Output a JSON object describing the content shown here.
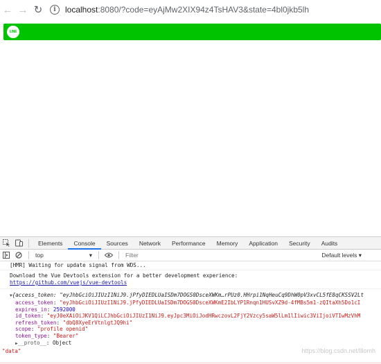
{
  "browser": {
    "url_host": "localhost",
    "url_rest": ":8080/?code=eyAjMw2XIX94z4TsHAV3&state=4bl0jkb5lh"
  },
  "line_logo_text": "LINE",
  "devtools": {
    "tabs": [
      "Elements",
      "Console",
      "Sources",
      "Network",
      "Performance",
      "Memory",
      "Application",
      "Security",
      "Audits"
    ],
    "active_tab": "Console",
    "context": "top",
    "filter_placeholder": "Filter",
    "levels": "Default levels ▾",
    "messages": {
      "hmr": "[HMR] Waiting for update signal from WDS...",
      "devtools_1": "Download the Vue Devtools extension for a better development experience:",
      "devtools_link": "https://github.com/vuejs/vue-devtools"
    },
    "object": {
      "summary": "{access_token: \"eyJhbGciOiJIUzI1NiJ9.jPfyDIEDLUaISDm7DOGS0DsceXWKm…rPUz0.HHrpi1NqHeuCq9DhW0pV3xvCL5fE8qCKSSV2Lt",
      "access_token": "\"eyJhbGciOiJIUzI1NiJ9.jPfyDIEDLUaISDm7DOGS0DsceXWKmE2IbLYP1Rnqn1HUSvXZ9d-4fMBs5m1-zQItaXh5Do1cI",
      "expires_in": "2592000",
      "id_token": "\"eyJ0eXAiOiJKV1QiLCJhbGciOiJIUzI1NiJ9.eyJpc3MiOiJodHRwczovL2FjY2Vzcy5saW5lLm1lIiwic3ViIjoiVTIwMzVhM",
      "refresh_token": "\"dbQ8XyeErVtnlgtJQ9hi\"",
      "scope": "\"profile openid\"",
      "token_type": "\"Bearer\"",
      "proto": "Object"
    },
    "data_string": "\"data\""
  },
  "watermark": "https://blog.csdn.net/lllomh"
}
